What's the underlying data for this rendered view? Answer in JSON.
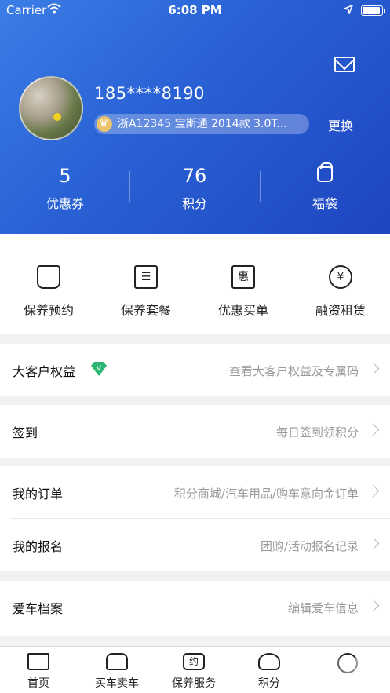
{
  "status": {
    "carrier": "Carrier",
    "time": "6:08 PM"
  },
  "profile": {
    "phone": "185****8190",
    "car": "浙A12345 宝斯通 2014款 3.0T...",
    "change": "更换"
  },
  "stats": [
    {
      "value": "5",
      "label": "优惠券"
    },
    {
      "value": "76",
      "label": "积分"
    },
    {
      "value": "",
      "label": "福袋"
    }
  ],
  "services": [
    {
      "label": "保养预约",
      "icon": "maintenance-icon"
    },
    {
      "label": "保养套餐",
      "icon": "package-icon",
      "glyph": ""
    },
    {
      "label": "优惠买单",
      "icon": "discount-icon",
      "glyph": "惠"
    },
    {
      "label": "融资租赁",
      "icon": "finance-icon",
      "glyph": "¥"
    }
  ],
  "rows": [
    {
      "title": "大客户权益",
      "hint": "查看大客户权益及专属码"
    },
    {
      "title": "签到",
      "hint": "每日签到领积分"
    },
    {
      "title": "我的订单",
      "hint": "积分商城/汽车用品/购车意向金订单"
    },
    {
      "title": "我的报名",
      "hint": "团购/活动报名记录"
    },
    {
      "title": "爱车档案",
      "hint": "编辑爱车信息"
    }
  ],
  "tabs": [
    {
      "label": "首页",
      "icon": "home-icon"
    },
    {
      "label": "买车卖车",
      "icon": "car-icon"
    },
    {
      "label": "保养服务",
      "icon": "appointment-icon",
      "glyph": "约"
    },
    {
      "label": "积分",
      "icon": "heart-points-icon"
    },
    {
      "label": "",
      "icon": "profile-icon"
    }
  ],
  "colors": {
    "hero_start": "#3b7de6",
    "hero_end": "#1e45c0",
    "vip_green": "#2bb673"
  }
}
